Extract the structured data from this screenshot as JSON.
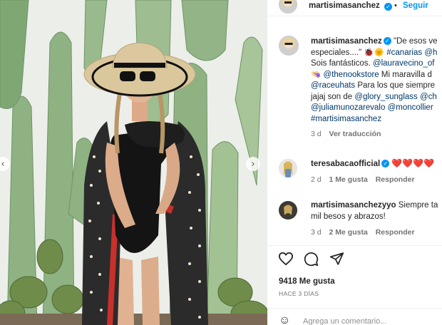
{
  "post": {
    "author": "martisimasanchez",
    "follow_label": "Seguir",
    "dot": "•",
    "caption_lines": [
      "\"De esos ve",
      "especiales....\"",
      "#canarias",
      "@h",
      "Sois fantásticos.",
      "@lauravecino_of",
      "@thenookstore",
      "Mi maravilla d",
      "@raceuhats",
      "Para los que siempre",
      "jajaj son de",
      "@glory_sunglass",
      "@ch",
      "@juliamunozarevalo",
      "@moncollier",
      "#martisimasanchez"
    ],
    "caption_meta": {
      "time": "3 d",
      "translate": "Ver traducción"
    }
  },
  "comments": [
    {
      "user": "teresabacaofficial",
      "hearts": "❤️❤️❤️❤️",
      "time": "2 d",
      "likes": "1 Me gusta",
      "reply": "Responder"
    },
    {
      "user": "martisimasanchezyyo",
      "text_1": "Siempre ta",
      "text_2": "mil besos y abrazos!",
      "time": "3 d",
      "likes": "2 Me gusta",
      "reply": "Responder"
    }
  ],
  "footer": {
    "likes": "9418 Me gusta",
    "ago": "HACE 3 DÍAS",
    "add_comment_placeholder": "Agrega un comentario..."
  },
  "icons": {
    "like": "heart-icon",
    "comment": "comment-icon",
    "share": "share-icon",
    "prev": "chevron-left-icon",
    "next": "chevron-right-icon"
  },
  "colors": {
    "link": "#00376b",
    "accent": "#0095f6",
    "like": "#ed4956"
  }
}
